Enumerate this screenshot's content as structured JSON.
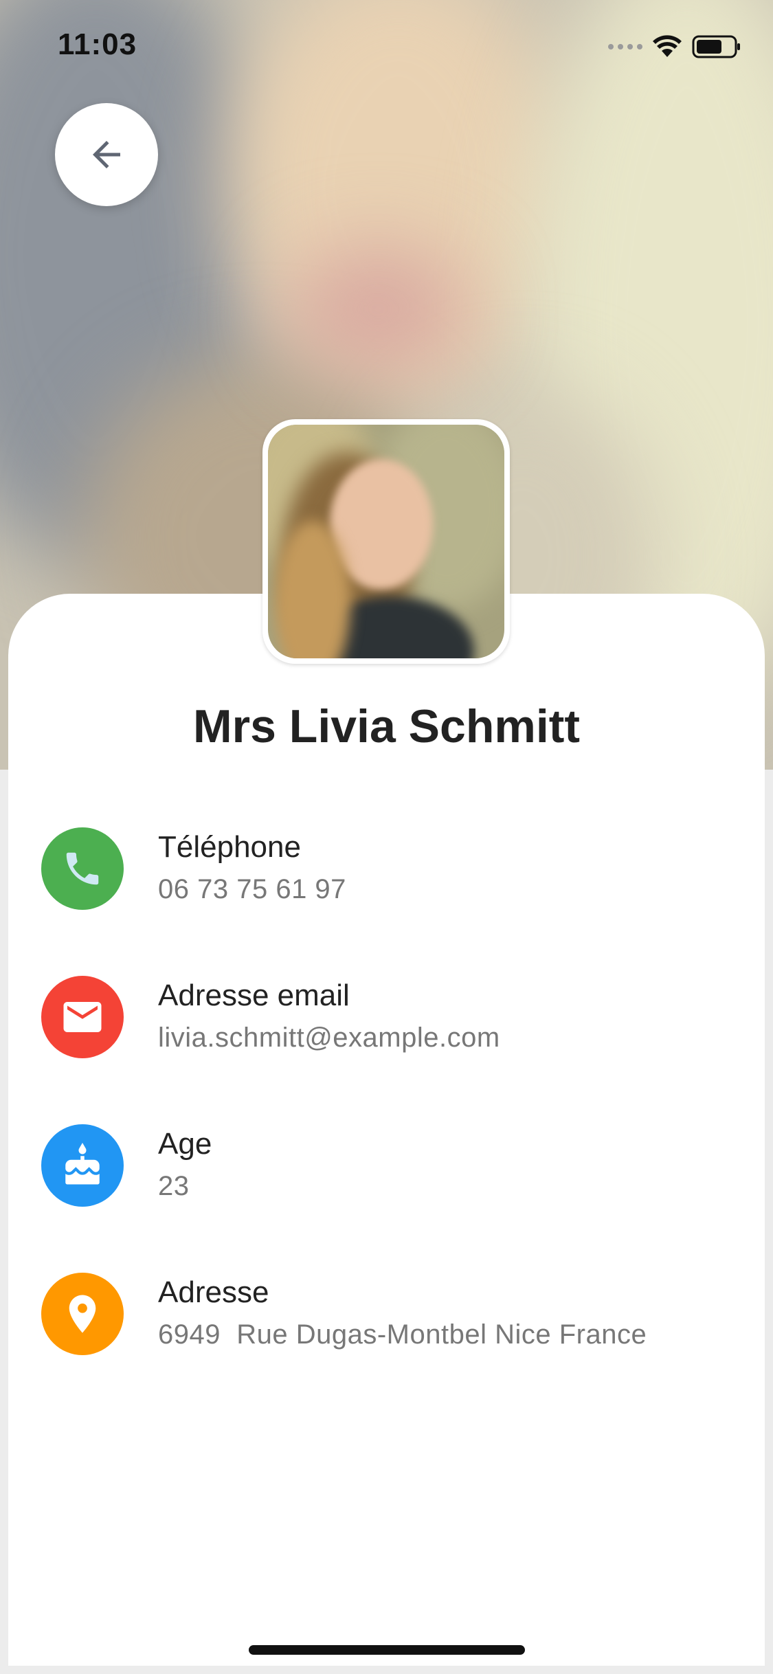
{
  "status_bar": {
    "time": "11:03"
  },
  "profile": {
    "full_name": "Mrs Livia Schmitt"
  },
  "details": [
    {
      "label": "Téléphone",
      "value": "06 73 75 61 97",
      "icon": "phone-icon",
      "color": "#4caf50"
    },
    {
      "label": "Adresse email",
      "value": "livia.schmitt@example.com",
      "icon": "mail-icon",
      "color": "#f44336"
    },
    {
      "label": "Age",
      "value": "23",
      "icon": "cake-icon",
      "color": "#2196f3"
    },
    {
      "label": "Adresse",
      "value": "6949  Rue Dugas-Montbel Nice France",
      "icon": "location-pin-icon",
      "color": "#ff9800"
    }
  ]
}
